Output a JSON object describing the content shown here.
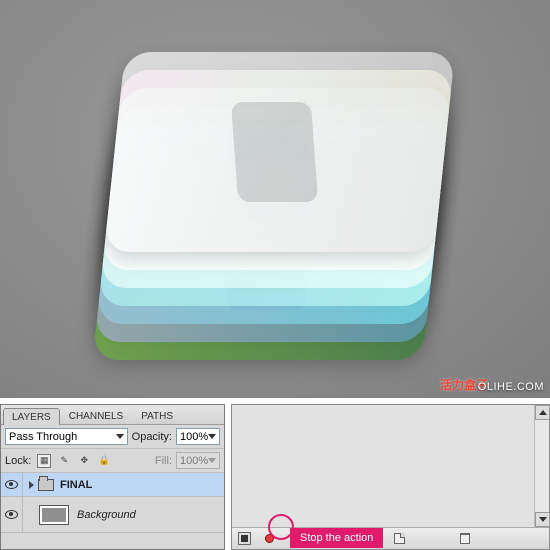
{
  "canvas": {
    "credit_cn": "活力盒子",
    "credit_en": "OLIHE.COM"
  },
  "layers_panel": {
    "tabs": [
      "LAYERS",
      "CHANNELS",
      "PATHS"
    ],
    "active_tab": 0,
    "blend_mode": "Pass Through",
    "opacity_label": "Opacity:",
    "opacity_value": "100%",
    "lock_label": "Lock:",
    "fill_label": "Fill:",
    "fill_value": "100%",
    "rows": [
      {
        "name": "FINAL",
        "type": "group"
      },
      {
        "name": "Background",
        "type": "layer"
      }
    ]
  },
  "actions_panel": {
    "buttons": {
      "stop": "stop",
      "record": "record",
      "play": "play",
      "new_set": "new-set",
      "new_action": "new-action",
      "delete": "delete"
    },
    "callout": "Stop the action"
  }
}
